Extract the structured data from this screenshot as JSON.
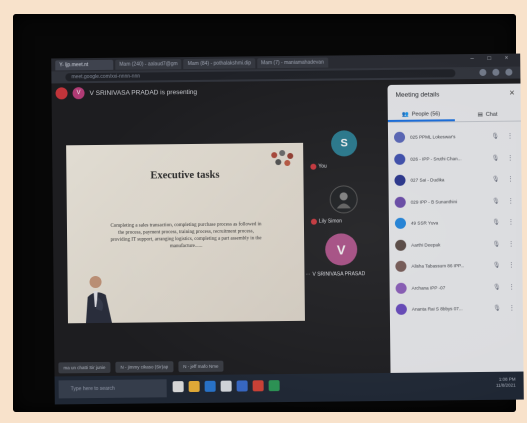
{
  "browser": {
    "tabs": [
      "Y- ljp.meet.nt",
      "Mam (240) - aalaud7@gm",
      "Mam (84) - pothalakshmi.dip",
      "Mam (7) - maniamahadevan"
    ],
    "url": "meet.google.com/xxi-nnnn-nnn"
  },
  "meet": {
    "presenter_initial": "V",
    "presenting_label": "V SRINIVASA PRADAD is presenting"
  },
  "slide": {
    "title": "Executive tasks",
    "body": "Completing a sales transaction, completing purchase process as followed in the process, payment process, training process, recruitment process, providing IT support, arranging logistics, completing a part assembly in the manufacture......"
  },
  "tiles": [
    {
      "initial": "S",
      "name": "You",
      "color": "#2a7f95"
    },
    {
      "initial": "",
      "name": "Lily Simon",
      "color": "#1d1f23"
    },
    {
      "initial": "V",
      "name": "V SRINIVASA PRASAD",
      "color": "#b1538c"
    }
  ],
  "panel": {
    "title": "Meeting details",
    "close": "×",
    "tab_people": "People (56)",
    "tab_chat": "Chat",
    "people": [
      {
        "name": "025 PPML Lokeswar's",
        "color": "#5c6bc0"
      },
      {
        "name": "026 - IPP - Sruthi Chan...",
        "color": "#3f51b5"
      },
      {
        "name": "027 Sai - Dudika",
        "color": "#283593"
      },
      {
        "name": "029 IPP - B Sunanthini",
        "color": "#6d4cb0"
      },
      {
        "name": "49 SSR Yuva",
        "color": "#1e88e5"
      },
      {
        "name": "Aarthi Deepak",
        "color": "#5a4a44"
      },
      {
        "name": "Alisha Tabassum 86 IPP...",
        "color": "#7a5c58"
      },
      {
        "name": "Archana IPP -07",
        "color": "#8e5fbf"
      },
      {
        "name": "Ananta Rai S 8bbys 07...",
        "color": "#6a4bc4"
      }
    ]
  },
  "controls": {
    "pills": [
      "ma un chatti Sir junie",
      "N - jimmy  cikaso  (Sir)ap",
      "N - jeff  mafo  Nme"
    ]
  },
  "taskbar": {
    "search": "Type here to search",
    "tray": [
      "1:08 PM",
      "11/8/2021"
    ]
  }
}
